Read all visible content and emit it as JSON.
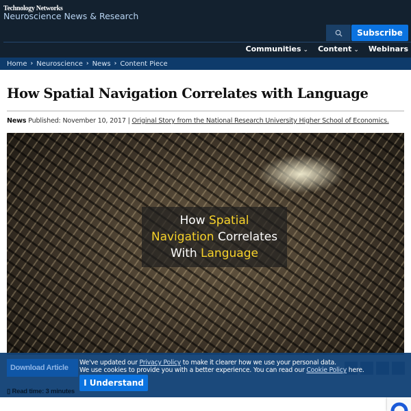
{
  "header": {
    "brand": "Technology Networks",
    "site": "Neuroscience News & Research",
    "subscribe": "Subscribe",
    "nav": [
      "Communities",
      "Content",
      "Webinars"
    ]
  },
  "breadcrumb": [
    "Home",
    "Neuroscience",
    "News",
    "Content Piece"
  ],
  "article": {
    "title": "How Spatial Navigation Correlates with Language",
    "type": "News",
    "published": "Published: November 10, 2017 |",
    "source": "Original Story from the National Research University Higher School of Economics.",
    "hero": {
      "w1": "How ",
      "w2": "Spatial",
      "w3": "Navigation",
      "w4": " Correlates",
      "w5": "With ",
      "w6": "Language"
    },
    "download": "Download Article",
    "read_time": "Read time: 3 minutes"
  },
  "cookie": {
    "t1": "We've updated our ",
    "privacy": "Privacy Policy",
    "t2": " to make it clearer how we use your personal data.",
    "t3": "We use cookies to provide you with a better experience. You can read our ",
    "cookie_policy": "Cookie Policy",
    "t4": " here.",
    "button": "I Understand"
  },
  "colors": {
    "header": "#13212f",
    "accent": "#0b73e0",
    "breadcrumb": "#0e3b6b",
    "highlight": "#f7d22a"
  }
}
